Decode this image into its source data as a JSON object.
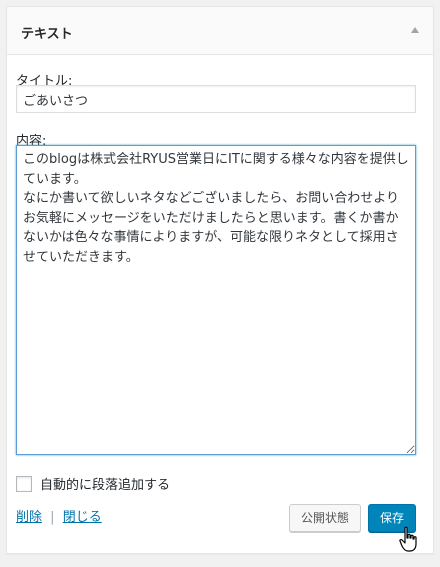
{
  "widget": {
    "title": "テキスト",
    "title_label": "タイトル:",
    "title_value": "ごあいさつ",
    "content_label": "内容:",
    "content_value": "このblogは株式会社RYUS営業日にITに関する様々な内容を提供しています。\nなにか書いて欲しいネタなどございましたら、お問い合わせよりお気軽にメッセージをいただけましたらと思います。書くか書かないかは色々な事情によりますが、可能な限りネタとして採用させていただきます。",
    "auto_paragraph_label": "自動的に段落追加する",
    "auto_paragraph_checked": false,
    "delete_link": "削除",
    "separator": "|",
    "close_link": "閉じる",
    "public_status_button": "公開状態",
    "save_button": "保存"
  },
  "colors": {
    "accent": "#0085ba",
    "link": "#0073aa",
    "focus_border": "#5b9dd9"
  },
  "icons": {
    "toggle": "triangle-up-icon",
    "cursor": "hand-pointer-cursor-icon"
  }
}
